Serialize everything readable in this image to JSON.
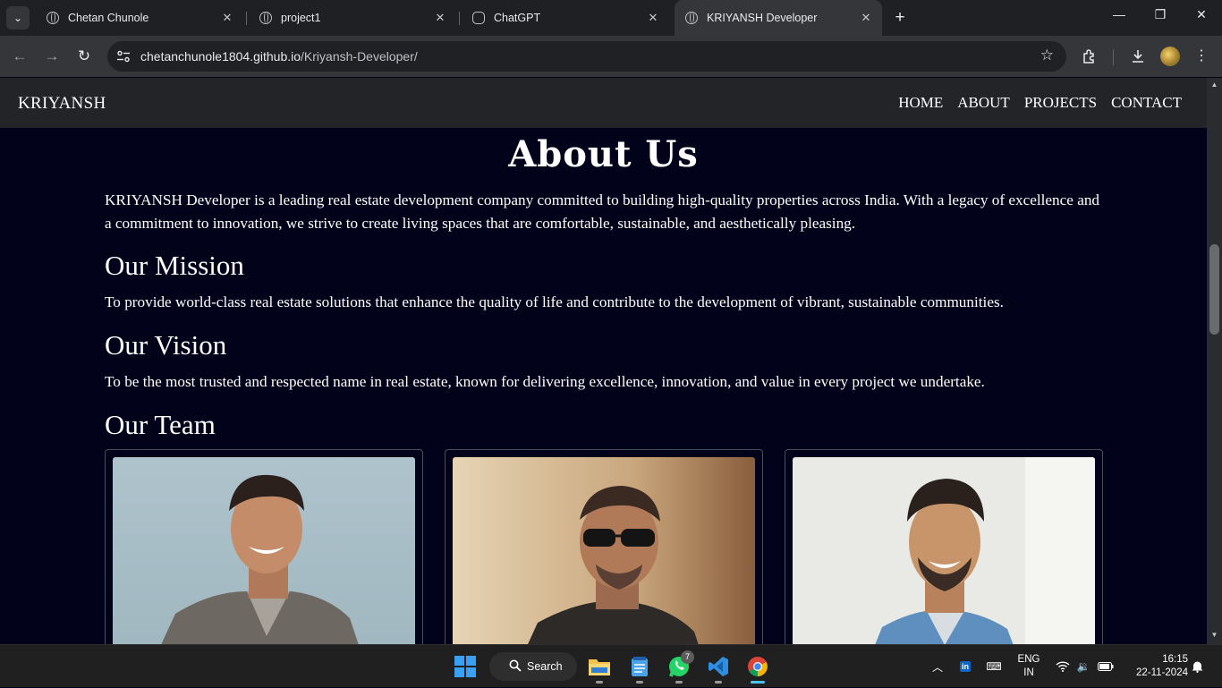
{
  "browser": {
    "tabs": [
      {
        "title": "Chetan Chunole",
        "active": false,
        "icon": "globe-icon"
      },
      {
        "title": "project1",
        "active": false,
        "icon": "globe-icon"
      },
      {
        "title": "ChatGPT",
        "active": false,
        "icon": "chatgpt-icon"
      },
      {
        "title": "KRIYANSH Developer",
        "active": true,
        "icon": "globe-icon"
      }
    ],
    "url_host": "chetanchunole1804.github.io",
    "url_path": "/Kriyansh-Developer/"
  },
  "site": {
    "brand": "KRIYANSH",
    "nav": [
      "HOME",
      "ABOUT",
      "PROJECTS",
      "CONTACT"
    ]
  },
  "about": {
    "title": "About Us",
    "intro": "KRIYANSH Developer is a leading real estate development company committed to building high-quality properties across India. With a legacy of excellence and a commitment to innovation, we strive to create living spaces that are comfortable, sustainable, and aesthetically pleasing.",
    "mission_heading": "Our Mission",
    "mission_text": "To provide world-class real estate solutions that enhance the quality of life and contribute to the development of vibrant, sustainable communities.",
    "vision_heading": "Our Vision",
    "vision_text": "To be the most trusted and respected name in real estate, known for delivering excellence, innovation, and value in every project we undertake.",
    "team_heading": "Our Team"
  },
  "taskbar": {
    "search_label": "Search",
    "whatsapp_badge": "7",
    "lang_line1": "ENG",
    "lang_line2": "IN",
    "time": "16:15",
    "date": "22-11-2024"
  },
  "colors": {
    "page_bg": "#02021a",
    "nav_bg": "#222428",
    "accent_taskbar": "#4cc2ff"
  }
}
